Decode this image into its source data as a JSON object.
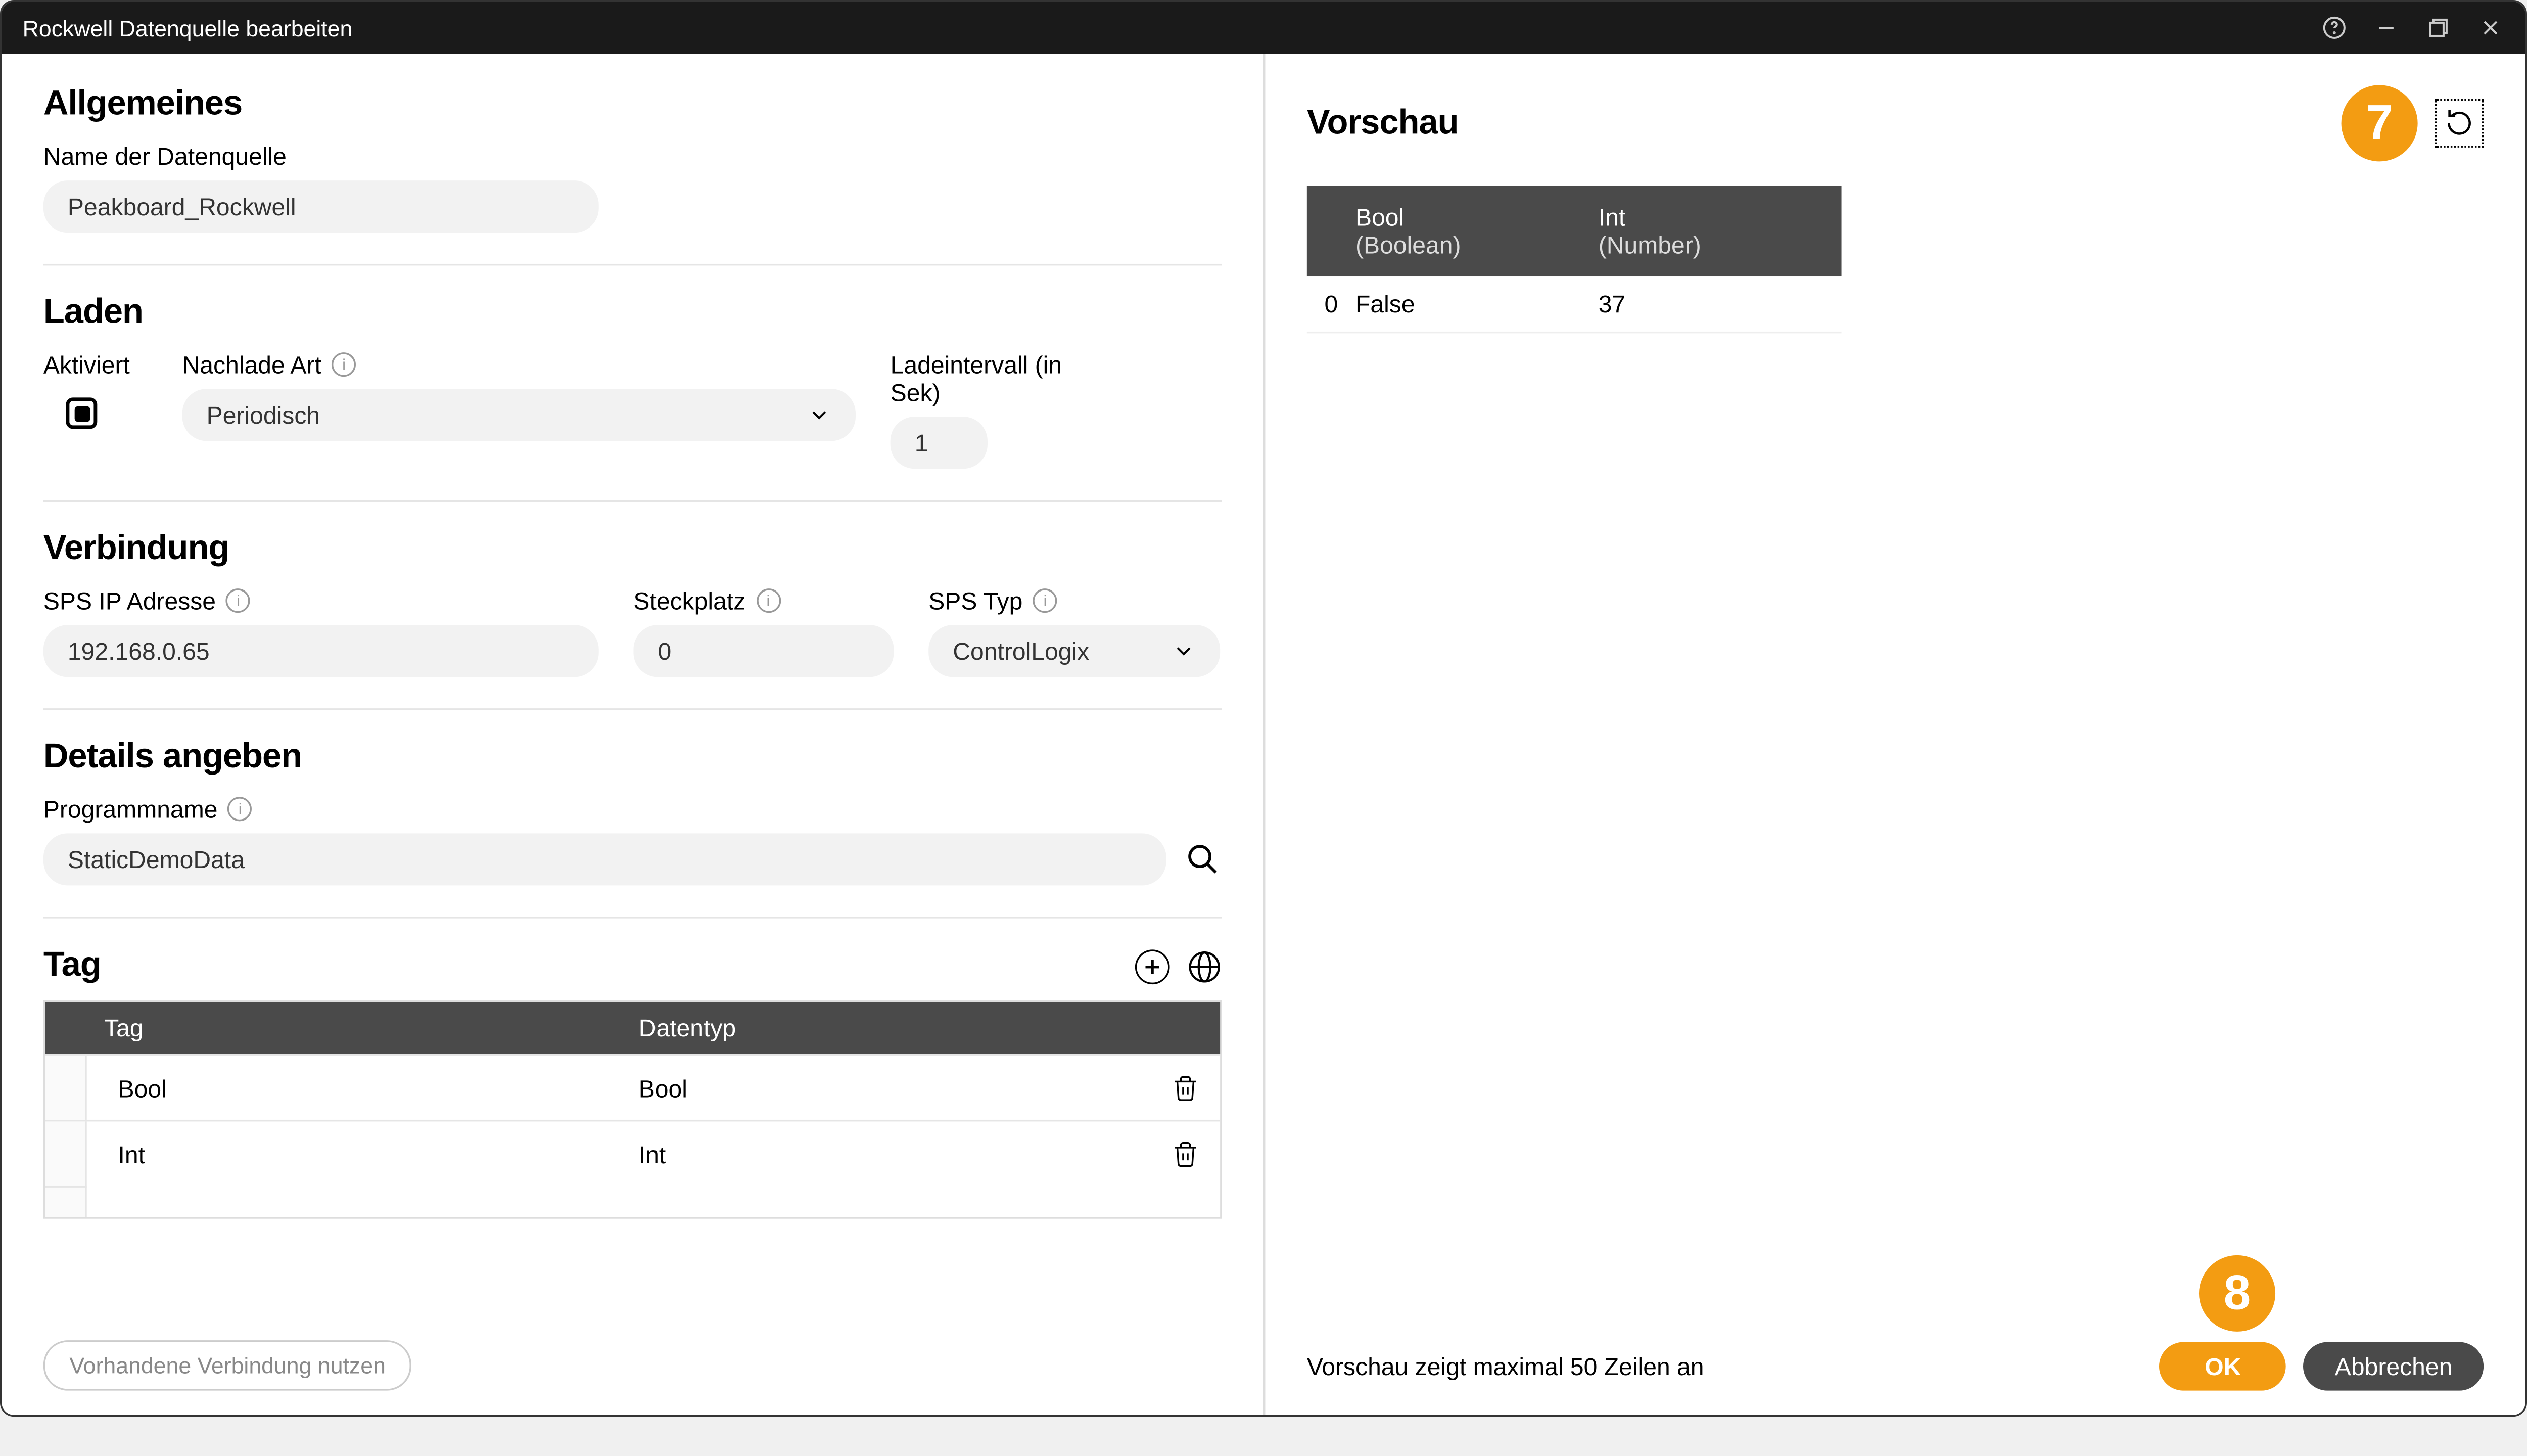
{
  "window": {
    "title": "Rockwell Datenquelle bearbeiten"
  },
  "sections": {
    "general": {
      "title": "Allgemeines",
      "name_label": "Name der Datenquelle",
      "name_value": "Peakboard_Rockwell"
    },
    "loading": {
      "title": "Laden",
      "activated_label": "Aktiviert",
      "reload_type_label": "Nachlade Art",
      "reload_type_value": "Periodisch",
      "interval_label": "Ladeintervall (in Sek)",
      "interval_value": "1"
    },
    "connection": {
      "title": "Verbindung",
      "ip_label": "SPS IP Adresse",
      "ip_value": "192.168.0.65",
      "slot_label": "Steckplatz",
      "slot_value": "0",
      "type_label": "SPS Typ",
      "type_value": "ControlLogix"
    },
    "details": {
      "title": "Details angeben",
      "progname_label": "Programmname",
      "progname_value": "StaticDemoData"
    },
    "tags": {
      "title": "Tag",
      "col_tag": "Tag",
      "col_type": "Datentyp",
      "rows": [
        {
          "name": "Bool",
          "type": "Bool"
        },
        {
          "name": "Int",
          "type": "Int"
        }
      ]
    }
  },
  "buttons": {
    "use_existing": "Vorhandene Verbindung nutzen",
    "ok": "OK",
    "cancel": "Abbrechen"
  },
  "preview": {
    "title": "Vorschau",
    "columns": [
      {
        "name": "Bool",
        "type": "(Boolean)"
      },
      {
        "name": "Int",
        "type": "(Number)"
      }
    ],
    "rows": [
      {
        "idx": "0",
        "cells": [
          "False",
          "37"
        ]
      }
    ],
    "footer_note": "Vorschau zeigt maximal 50 Zeilen an"
  },
  "annotations": {
    "step7": "7",
    "step8": "8"
  }
}
